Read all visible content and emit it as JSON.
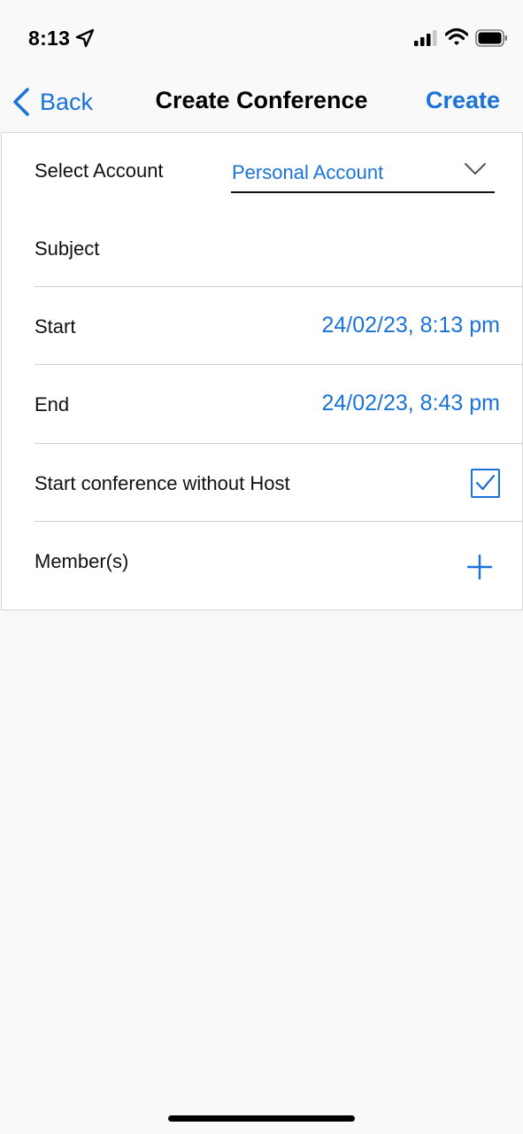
{
  "status_bar": {
    "time": "8:13",
    "icons": [
      "location-arrow-icon",
      "cellular-signal-icon",
      "wifi-icon",
      "battery-icon"
    ]
  },
  "nav": {
    "back_label": "Back",
    "title": "Create Conference",
    "create_label": "Create"
  },
  "form": {
    "account": {
      "label": "Select Account",
      "value": "Personal Account"
    },
    "subject": {
      "label": "Subject",
      "value": "",
      "placeholder": ""
    },
    "start": {
      "label": "Start",
      "value": "24/02/23, 8:13 pm"
    },
    "end": {
      "label": "End",
      "value": "24/02/23, 8:43 pm"
    },
    "without_host": {
      "label": "Start conference without Host",
      "checked": true
    },
    "members": {
      "label": "Member(s)"
    }
  },
  "colors": {
    "accent": "#1a73d9",
    "background": "#f9f9f9",
    "card": "#ffffff",
    "divider": "#d0d0d0"
  }
}
